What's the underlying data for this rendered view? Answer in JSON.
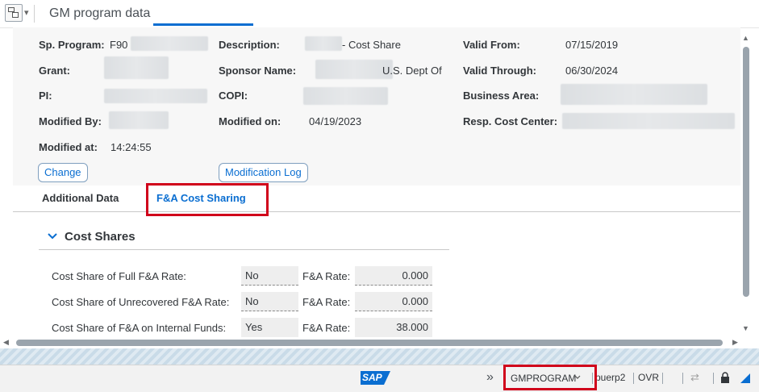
{
  "window": {
    "title": "GM program data"
  },
  "header": {
    "sp_program_label": "Sp. Program:",
    "sp_program_value": "F90",
    "description_label": "Description:",
    "description_value": "- Cost Share",
    "valid_from_label": "Valid From:",
    "valid_from_value": "07/15/2019",
    "grant_label": "Grant:",
    "sponsor_name_label": "Sponsor Name:",
    "sponsor_name_value": "U.S. Dept Of",
    "valid_through_label": "Valid Through:",
    "valid_through_value": "06/30/2024",
    "pi_label": "PI:",
    "copi_label": "COPI:",
    "business_area_label": "Business Area:",
    "modified_by_label": "Modified By:",
    "modified_on_label": "Modified on:",
    "modified_on_value": "04/19/2023",
    "resp_cost_center_label": "Resp. Cost Center:",
    "modified_at_label": "Modified at:",
    "modified_at_value": "14:24:55",
    "change_button": "Change",
    "modification_log_button": "Modification Log"
  },
  "tabs": [
    {
      "label": "Additional Data"
    },
    {
      "label": "F&A Cost Sharing"
    }
  ],
  "cost_shares": {
    "title": "Cost Shares",
    "fa_rate_label": "F&A Rate:",
    "rows": [
      {
        "label": "Cost Share of Full F&A Rate:",
        "value": "No",
        "rate": "0.000"
      },
      {
        "label": "Cost Share of Unrecovered F&A Rate:",
        "value": "No",
        "rate": "0.000"
      },
      {
        "label": "Cost Share of F&A on Internal Funds:",
        "value": "Yes",
        "rate": "38.000"
      }
    ]
  },
  "status_bar": {
    "logo_text": "SAP",
    "transaction": "GMPROGRAM",
    "user": "puerp2",
    "mode": "OVR"
  },
  "colors": {
    "accent": "#0a6ed1",
    "highlight": "#d0021b"
  }
}
